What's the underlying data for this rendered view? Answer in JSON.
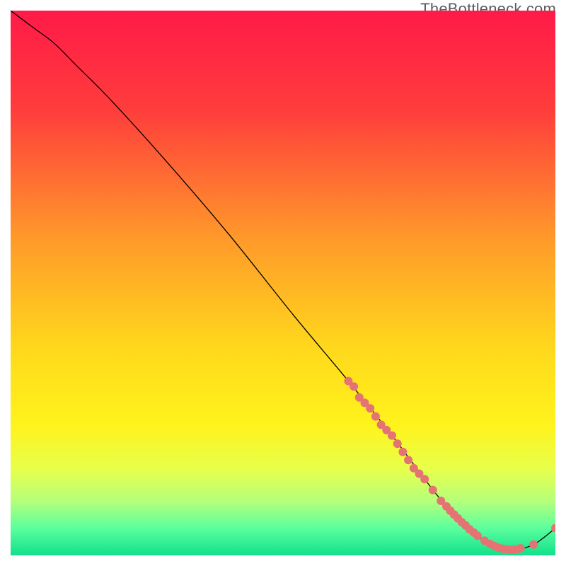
{
  "watermark": "TheBottleneck.com",
  "chart_data": {
    "type": "line",
    "title": "",
    "xlabel": "",
    "ylabel": "",
    "xlim": [
      0,
      100
    ],
    "ylim": [
      0,
      100
    ],
    "grid": false,
    "legend": false,
    "gradient_stops": [
      {
        "pct": 0,
        "color": "#ff1a48"
      },
      {
        "pct": 18,
        "color": "#ff3c3c"
      },
      {
        "pct": 42,
        "color": "#ff9a2a"
      },
      {
        "pct": 62,
        "color": "#ffd81c"
      },
      {
        "pct": 76,
        "color": "#fff31c"
      },
      {
        "pct": 84,
        "color": "#e8ff4a"
      },
      {
        "pct": 90,
        "color": "#b6ff7a"
      },
      {
        "pct": 95,
        "color": "#5bff9e"
      },
      {
        "pct": 100,
        "color": "#12e08c"
      }
    ],
    "series": [
      {
        "name": "bottleneck-curve",
        "color": "#000000",
        "stroke_width": 1.3,
        "x": [
          0,
          4,
          8,
          12,
          18,
          28,
          40,
          52,
          62,
          70,
          76,
          80,
          84,
          88,
          92,
          96,
          100
        ],
        "y": [
          100,
          97,
          94,
          90,
          84,
          73,
          59,
          44,
          32,
          22,
          14,
          9,
          5,
          2,
          1,
          2,
          5
        ]
      }
    ],
    "marker_groups": [
      {
        "name": "dense-cluster-upper",
        "color": "#e57373",
        "radius": 6,
        "points": [
          {
            "x": 62,
            "y": 32
          },
          {
            "x": 63,
            "y": 31
          },
          {
            "x": 64,
            "y": 29
          },
          {
            "x": 65,
            "y": 28
          },
          {
            "x": 66,
            "y": 27
          },
          {
            "x": 67,
            "y": 25.5
          },
          {
            "x": 68,
            "y": 24
          },
          {
            "x": 69,
            "y": 23
          },
          {
            "x": 70,
            "y": 22
          },
          {
            "x": 71,
            "y": 20.5
          },
          {
            "x": 72,
            "y": 19
          },
          {
            "x": 73,
            "y": 17.5
          },
          {
            "x": 74,
            "y": 16
          },
          {
            "x": 75,
            "y": 15
          },
          {
            "x": 76,
            "y": 14
          }
        ]
      },
      {
        "name": "mid-gap-points",
        "color": "#e57373",
        "radius": 6,
        "points": [
          {
            "x": 77.5,
            "y": 12
          },
          {
            "x": 79,
            "y": 10
          }
        ]
      },
      {
        "name": "dense-cluster-lower",
        "color": "#e57373",
        "radius": 6,
        "points": [
          {
            "x": 80,
            "y": 9
          },
          {
            "x": 80.7,
            "y": 8.2
          },
          {
            "x": 81.4,
            "y": 7.5
          },
          {
            "x": 82.1,
            "y": 6.8
          },
          {
            "x": 82.8,
            "y": 6.1
          },
          {
            "x": 83.5,
            "y": 5.5
          },
          {
            "x": 84.2,
            "y": 4.8
          },
          {
            "x": 85,
            "y": 4.2
          },
          {
            "x": 85.7,
            "y": 3.6
          }
        ]
      },
      {
        "name": "valley-points",
        "color": "#e57373",
        "radius": 6,
        "points": [
          {
            "x": 87,
            "y": 2.7
          },
          {
            "x": 88,
            "y": 2.1
          },
          {
            "x": 88.8,
            "y": 1.7
          },
          {
            "x": 89.6,
            "y": 1.4
          },
          {
            "x": 90.4,
            "y": 1.2
          },
          {
            "x": 91.2,
            "y": 1.1
          },
          {
            "x": 92,
            "y": 1.0
          },
          {
            "x": 92.8,
            "y": 1.1
          },
          {
            "x": 93.6,
            "y": 1.3
          }
        ]
      },
      {
        "name": "rise-points",
        "color": "#e57373",
        "radius": 6,
        "points": [
          {
            "x": 96,
            "y": 2.0
          },
          {
            "x": 100,
            "y": 5.0
          }
        ]
      }
    ]
  }
}
